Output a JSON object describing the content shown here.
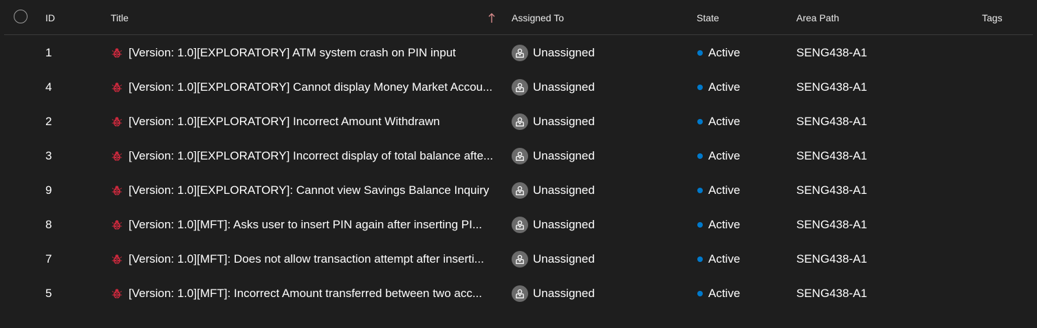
{
  "columns": {
    "id": "ID",
    "title": "Title",
    "title_sort": "ascending",
    "assigned_to": "Assigned To",
    "state": "State",
    "area_path": "Area Path",
    "tags": "Tags"
  },
  "colors": {
    "background": "#1e1e1e",
    "bug_icon": "#cc293d",
    "state_active": "#007acc",
    "avatar_bg": "#6b6b6b"
  },
  "rows": [
    {
      "id": "1",
      "title": "[Version: 1.0][EXPLORATORY] ATM system crash on PIN input",
      "work_item_type_icon": "bug-icon",
      "assigned_to": "Unassigned",
      "state": "Active",
      "area_path": "SENG438-A1",
      "tags": ""
    },
    {
      "id": "4",
      "title": "[Version: 1.0][EXPLORATORY] Cannot display Money Market Accou...",
      "work_item_type_icon": "bug-icon",
      "assigned_to": "Unassigned",
      "state": "Active",
      "area_path": "SENG438-A1",
      "tags": ""
    },
    {
      "id": "2",
      "title": "[Version: 1.0][EXPLORATORY] Incorrect Amount Withdrawn",
      "work_item_type_icon": "bug-icon",
      "assigned_to": "Unassigned",
      "state": "Active",
      "area_path": "SENG438-A1",
      "tags": ""
    },
    {
      "id": "3",
      "title": "[Version: 1.0][EXPLORATORY] Incorrect display of total balance afte...",
      "work_item_type_icon": "bug-icon",
      "assigned_to": "Unassigned",
      "state": "Active",
      "area_path": "SENG438-A1",
      "tags": ""
    },
    {
      "id": "9",
      "title": "[Version: 1.0][EXPLORATORY]: Cannot view Savings Balance Inquiry",
      "work_item_type_icon": "bug-icon",
      "assigned_to": "Unassigned",
      "state": "Active",
      "area_path": "SENG438-A1",
      "tags": ""
    },
    {
      "id": "8",
      "title": "[Version: 1.0][MFT]: Asks user to insert PIN again after inserting PI...",
      "work_item_type_icon": "bug-icon",
      "assigned_to": "Unassigned",
      "state": "Active",
      "area_path": "SENG438-A1",
      "tags": ""
    },
    {
      "id": "7",
      "title": "[Version: 1.0][MFT]: Does not allow transaction attempt after inserti...",
      "work_item_type_icon": "bug-icon",
      "assigned_to": "Unassigned",
      "state": "Active",
      "area_path": "SENG438-A1",
      "tags": ""
    },
    {
      "id": "5",
      "title": "[Version: 1.0][MFT]: Incorrect Amount transferred between two acc...",
      "work_item_type_icon": "bug-icon",
      "assigned_to": "Unassigned",
      "state": "Active",
      "area_path": "SENG438-A1",
      "tags": ""
    }
  ]
}
